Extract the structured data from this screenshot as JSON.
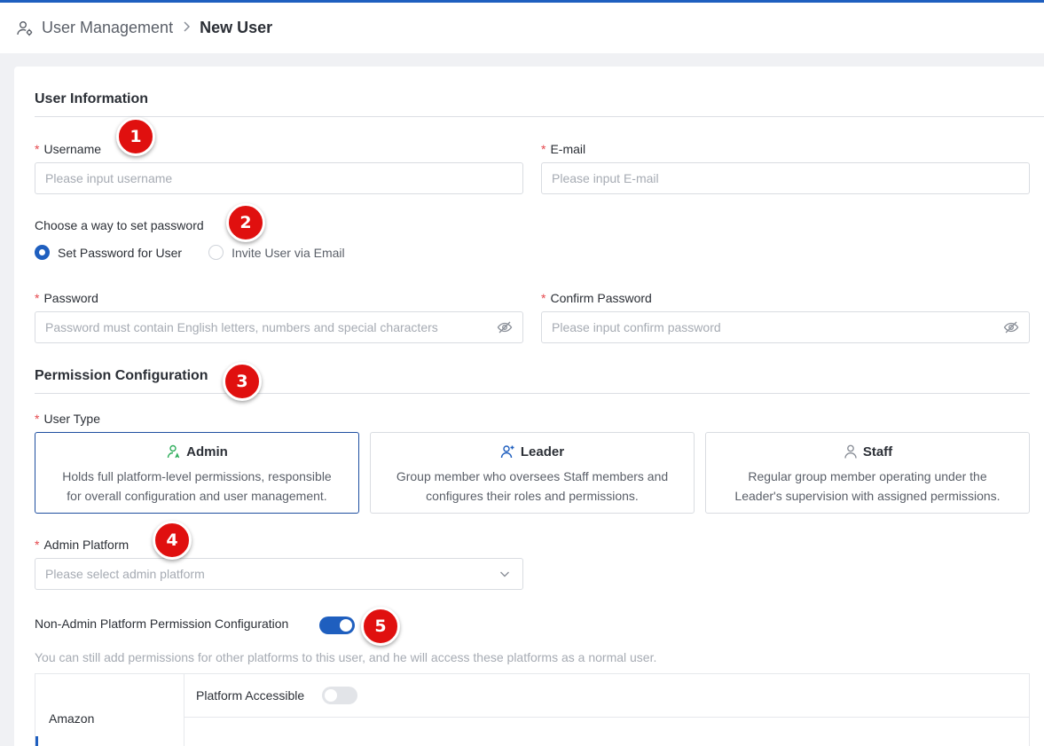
{
  "breadcrumb": {
    "root": "User Management",
    "separator": ">",
    "current": "New User",
    "icon": "user-gear-icon"
  },
  "user_info": {
    "title": "User Information",
    "username": {
      "label": "Username",
      "required": "*",
      "placeholder": "Please input username"
    },
    "email": {
      "label": "E-mail",
      "required": "*",
      "placeholder": "Please input E-mail"
    },
    "password_method": {
      "label": "Choose a way to set password",
      "options": [
        {
          "label": "Set Password for User",
          "checked": true
        },
        {
          "label": "Invite User via Email",
          "checked": false
        }
      ]
    },
    "password": {
      "label": "Password",
      "required": "*",
      "placeholder": "Password must contain English letters, numbers and special characters",
      "icon": "eye-off-icon"
    },
    "confirm_password": {
      "label": "Confirm Password",
      "required": "*",
      "placeholder": "Please input confirm password",
      "icon": "eye-off-icon"
    }
  },
  "permission": {
    "title": "Permission Configuration",
    "user_type": {
      "label": "User Type",
      "required": "*",
      "options": [
        {
          "name": "Admin",
          "icon": "admin-user-icon",
          "desc1": "Holds full platform-level permissions, responsible",
          "desc2": "for overall configuration and user management.",
          "selected": true
        },
        {
          "name": "Leader",
          "icon": "leader-user-icon",
          "desc1": "Group member who oversees Staff members and",
          "desc2": "configures their roles and permissions.",
          "selected": false
        },
        {
          "name": "Staff",
          "icon": "staff-user-icon",
          "desc1": "Regular group member operating under the",
          "desc2": "Leader's supervision with assigned permissions.",
          "selected": false
        }
      ]
    },
    "admin_platform": {
      "label": "Admin Platform",
      "required": "*",
      "placeholder": "Please select admin platform",
      "icon": "chevron-down-icon"
    },
    "non_admin": {
      "label": "Non-Admin Platform Permission Configuration",
      "enabled": true,
      "hint": "You can still add permissions for other platforms to this user, and he will access these platforms as a normal user.",
      "platforms": [
        {
          "name": "Amazon"
        }
      ],
      "platform_accessible": {
        "label": "Platform Accessible",
        "enabled": false
      }
    }
  },
  "badges": [
    "1",
    "2",
    "3",
    "4",
    "5"
  ],
  "colors": {
    "primary": "#1f5fbf",
    "required": "#e5484d",
    "badge": "#e0100f",
    "admin_icon": "#2fae5c"
  }
}
